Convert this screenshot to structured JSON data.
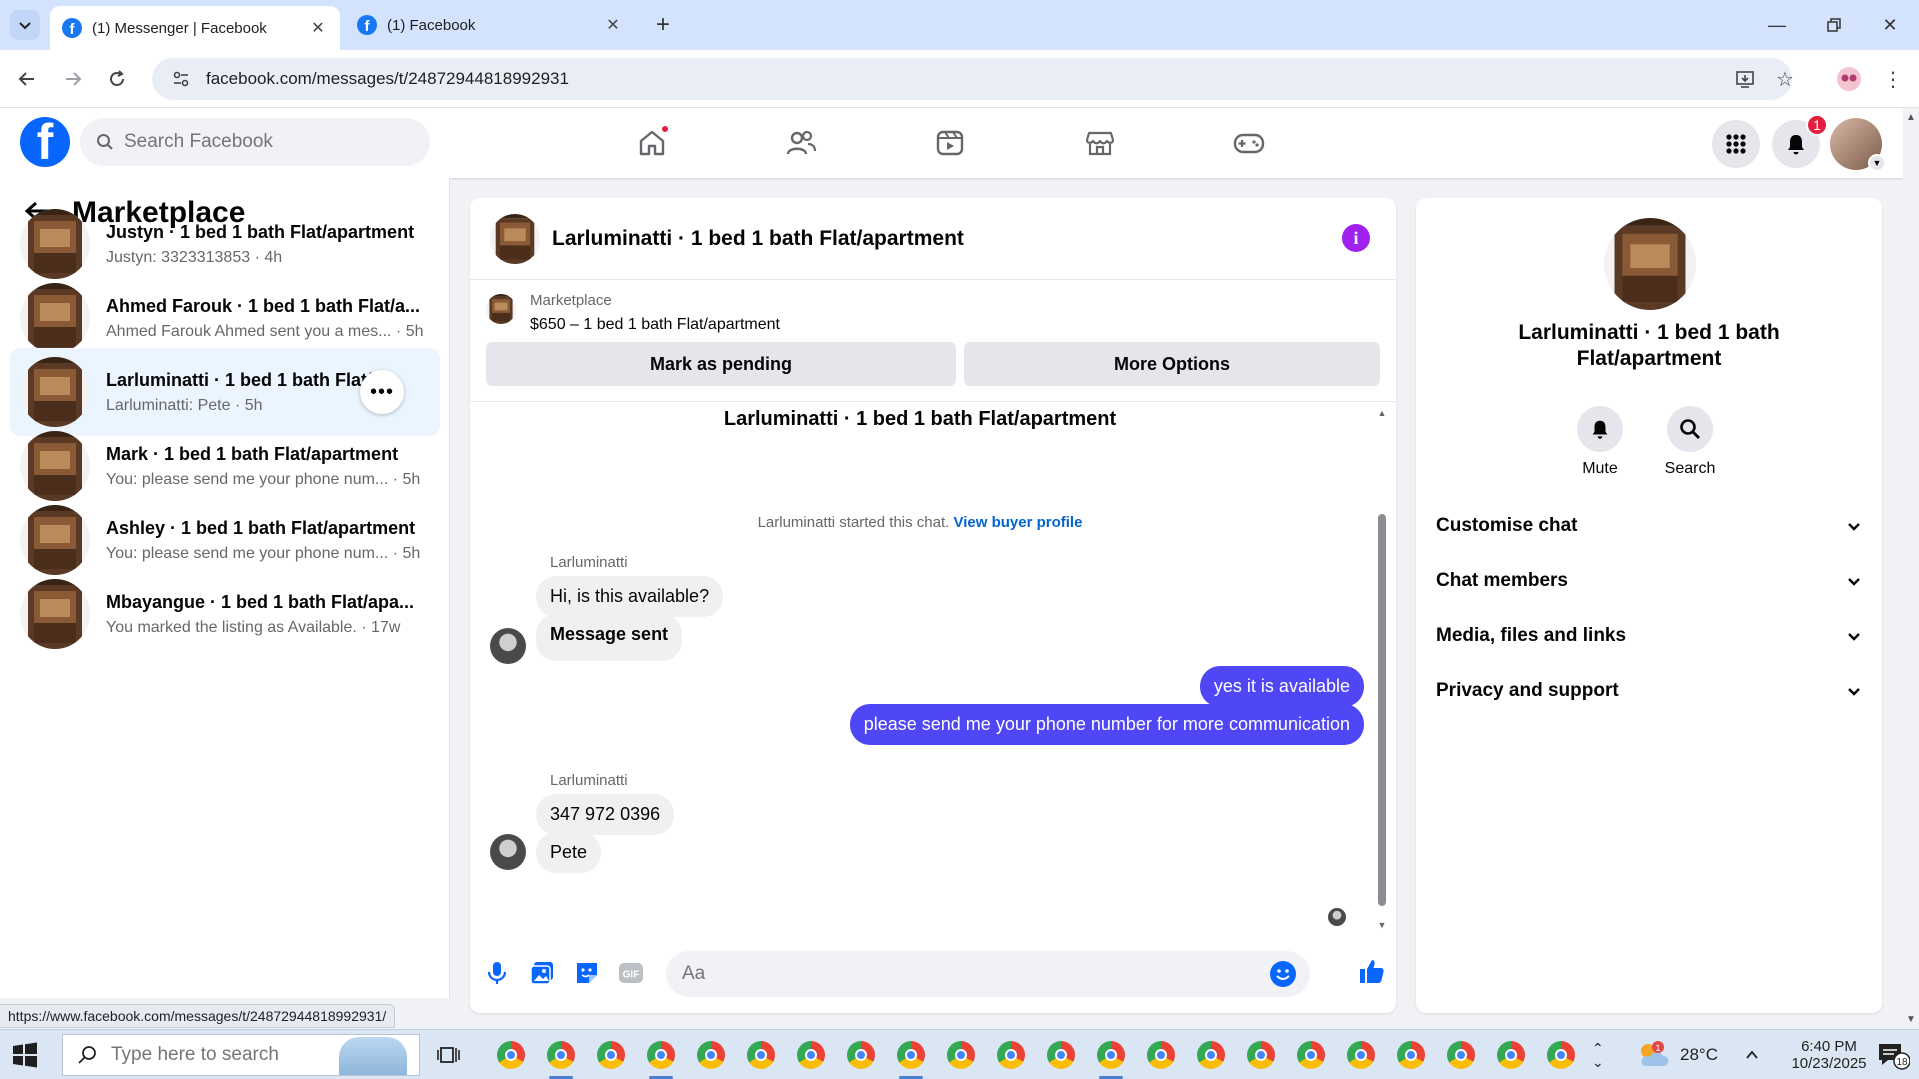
{
  "browser": {
    "tabs": [
      {
        "title": "(1) Messenger | Facebook",
        "active": true
      },
      {
        "title": "(1) Facebook",
        "active": false
      }
    ],
    "url": "facebook.com/messages/t/24872944818992931",
    "status_url": "https://www.facebook.com/messages/t/24872944818992931/"
  },
  "fb_nav": {
    "search_placeholder": "Search Facebook",
    "notification_count": "1"
  },
  "left_panel": {
    "title": "Marketplace",
    "chats": [
      {
        "title": "Justyn · 1 bed 1 bath Flat/apartment",
        "subtitle": "Justyn: 3323313853 · 4h"
      },
      {
        "title": "Ahmed Farouk · 1 bed 1 bath Flat/a...",
        "subtitle": "Ahmed Farouk Ahmed sent you a mes... · 5h"
      },
      {
        "title": "Larluminatti · 1 bed 1 bath Flat/...",
        "subtitle": "Larluminatti: Pete · 5h"
      },
      {
        "title": "Mark · 1 bed 1 bath Flat/apartment",
        "subtitle": "You: please send me your phone num... · 5h"
      },
      {
        "title": "Ashley · 1 bed 1 bath Flat/apartment",
        "subtitle": "You: please send me your phone num... · 5h"
      },
      {
        "title": "Mbayangue · 1 bed 1 bath Flat/apa...",
        "subtitle": "You marked the listing as Available. · 17w"
      }
    ]
  },
  "conversation": {
    "title": "Larluminatti · 1 bed 1 bath Flat/apartment",
    "listing_label": "Marketplace",
    "listing_price": "$650 – 1 bed 1 bath Flat/apartment",
    "mark_pending": "Mark as pending",
    "more_options": "More Options",
    "started_text": "Larluminatti started this chat.",
    "view_profile": "View buyer profile",
    "sender_name": "Larluminatti",
    "messages": [
      {
        "text": "Hi, is this available?",
        "dir": "in"
      },
      {
        "text": "Message sent",
        "dir": "in"
      },
      {
        "text": "yes it is available",
        "dir": "out"
      },
      {
        "text": "please send me your phone number for more communication",
        "dir": "out"
      },
      {
        "text": "347 972 0396",
        "dir": "in"
      },
      {
        "text": "Pete",
        "dir": "in"
      }
    ],
    "composer_placeholder": "Aa",
    "composer_gif": "GIF"
  },
  "right_panel": {
    "name": "Larluminatti · 1 bed 1 bath Flat/apartment",
    "mute": "Mute",
    "search": "Search",
    "sections": [
      "Customise chat",
      "Chat members",
      "Media, files and links",
      "Privacy and support"
    ]
  },
  "taskbar": {
    "search_placeholder": "Type here to search",
    "weather": "28°C",
    "time": "6:40 PM",
    "date": "10/23/2025",
    "notification_count": "18",
    "weather_badge": "1"
  },
  "colors": {
    "fb_blue": "#0866ff",
    "outgoing_bubble": "#4f46f5",
    "selected_chat": "#ebf5ff",
    "info_purple": "#a020f0"
  }
}
